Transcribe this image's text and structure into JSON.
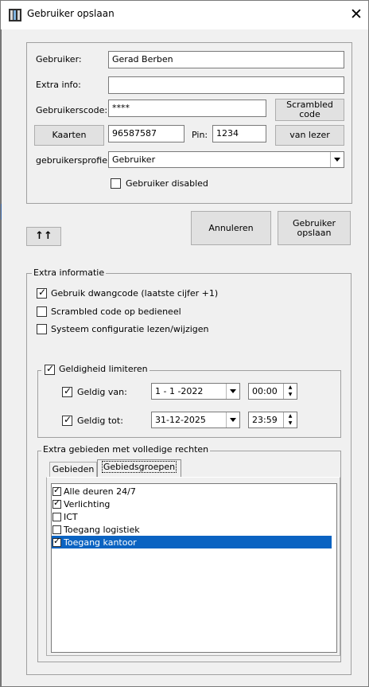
{
  "window": {
    "title": "Gebruiker opslaan",
    "close_glyph": "✕"
  },
  "form": {
    "gebruiker_label": "Gebruiker:",
    "gebruiker_value": "Gerad Berben",
    "extra_info_label": "Extra info:",
    "extra_info_value": "",
    "gebruikerscode_label": "Gebruikerscode:",
    "gebruikerscode_value": "****",
    "scrambled_button": "Scrambled code",
    "kaarten_button": "Kaarten",
    "kaart_value": "96587587",
    "pin_label": "Pin:",
    "pin_value": "1234",
    "van_lezer_button": "van lezer",
    "profiel_label": "gebruikersprofiel",
    "profiel_value": "Gebruiker",
    "disabled_label": "Gebruiker disabled",
    "disabled_checked": false
  },
  "actions": {
    "up_glyph": "↑↑",
    "annuleren": "Annuleren",
    "opslaan": "Gebruiker opslaan"
  },
  "extra": {
    "legend": "Extra informatie",
    "options": [
      {
        "label": "Gebruik dwangcode (laatste cijfer +1)",
        "checked": true
      },
      {
        "label": "Scrambled code op bedieneel",
        "checked": false
      },
      {
        "label": "Systeem configuratie lezen/wijzigen",
        "checked": false
      }
    ]
  },
  "validity": {
    "legend": "Geldigheid limiteren",
    "limit_checked": true,
    "van_label": "Geldig van:",
    "van_checked": true,
    "van_date": "1 - 1 -2022",
    "van_time": "00:00",
    "tot_label": "Geldig tot:",
    "tot_checked": true,
    "tot_date": "31-12-2025",
    "tot_time": "23:59"
  },
  "areas": {
    "legend": "Extra gebieden met volledige rechten",
    "tabs": [
      "Gebieden",
      "Gebiedsgroepen"
    ],
    "active_tab": "Gebiedsgroepen",
    "items": [
      {
        "label": "Alle deuren 24/7",
        "checked": true,
        "selected": false
      },
      {
        "label": "Verlichting",
        "checked": true,
        "selected": false
      },
      {
        "label": "ICT",
        "checked": false,
        "selected": false
      },
      {
        "label": "Toegang logistiek",
        "checked": false,
        "selected": false
      },
      {
        "label": "Toegang kantoor",
        "checked": true,
        "selected": true
      }
    ]
  },
  "colors": {
    "selection": "#0a63c2",
    "background": "#f0f0f0"
  }
}
